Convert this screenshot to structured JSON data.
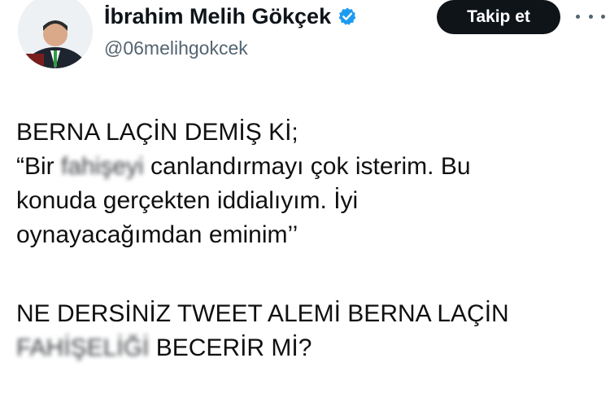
{
  "header": {
    "display_name": "İbrahim Melih Gökçek",
    "handle": "@06melihgokcek",
    "follow_label": "Takip et",
    "verified_color": "#1d9bf0"
  },
  "icons": {
    "verified": "verified-badge-icon",
    "more": "more-options-icon"
  },
  "tweet": {
    "line1": "BERNA LAÇİN DEMİŞ Kİ;",
    "line2_a": "“Bir ",
    "line2_blur": "fahişeyi",
    "line2_b": " canlandırmayı çok isterim. Bu",
    "line3": "konuda gerçekten iddialıyım. İyi",
    "line4": "oynayacağımdan eminim’’",
    "line5": "NE DERSİNİZ TWEET ALEMİ  BERNA LAÇİN",
    "line6_blur": "FAHİŞELİĞİ",
    "line6_b": " BECERİR Mİ?"
  }
}
